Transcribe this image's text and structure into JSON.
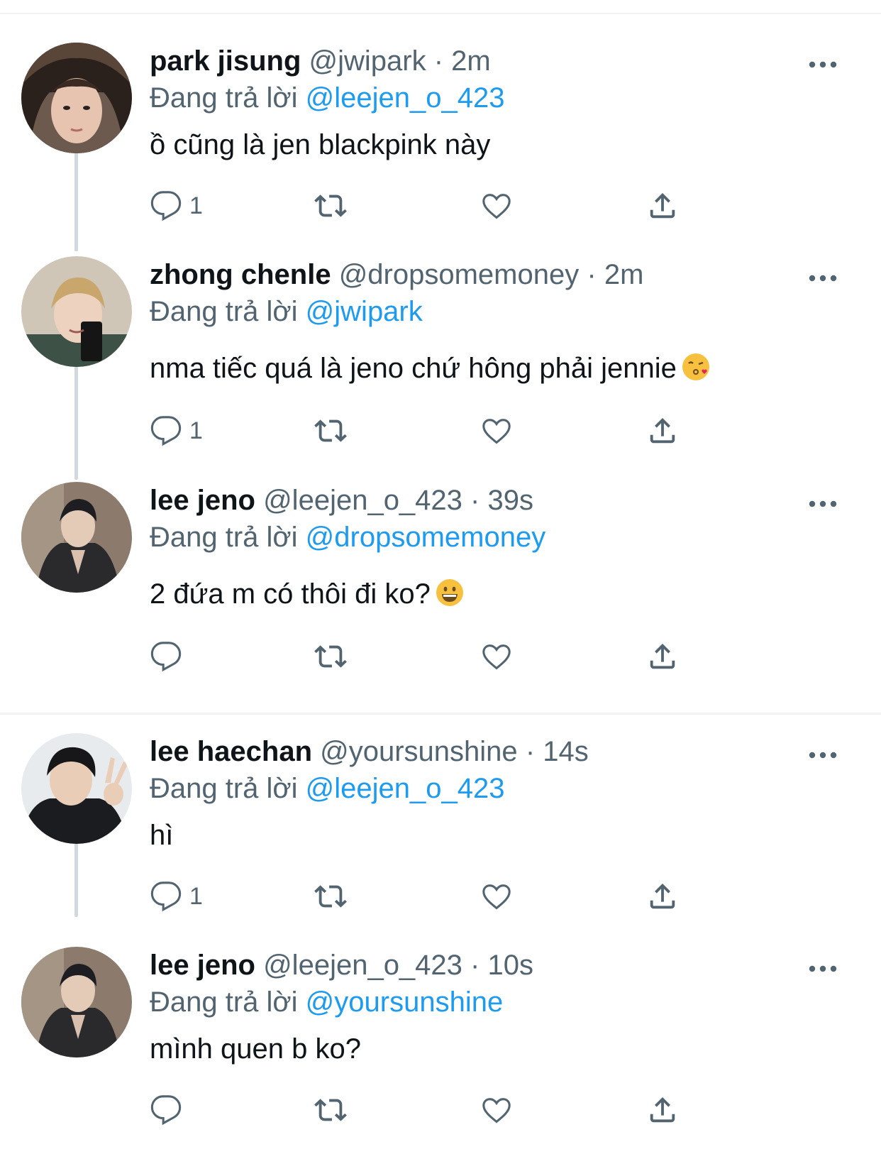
{
  "reply_prefix": "Đang trả lời",
  "colors": {
    "mention": "#1d9bf0",
    "muted": "#536471",
    "line": "#cfd9de"
  },
  "tweets": [
    {
      "name": "park jisung",
      "handle": "@jwipark",
      "separator": "·",
      "time": "2m",
      "replying_to": "@leejen_o_423",
      "text": "ồ cũng là jen blackpink này",
      "reply_count": "1"
    },
    {
      "name": "zhong chenle",
      "handle": "@dropsomemoney",
      "separator": "·",
      "time": "2m",
      "replying_to": "@jwipark",
      "text": "nma tiếc quá là jeno chứ hông phải jennie",
      "emoji": "kissing-heart-emoji",
      "reply_count": "1"
    },
    {
      "name": "lee jeno",
      "handle": "@leejen_o_423",
      "separator": "·",
      "time": "39s",
      "replying_to": "@dropsomemoney",
      "text": "2 đứa m có thôi đi ko?",
      "emoji": "grinning-emoji",
      "reply_count": ""
    },
    {
      "name": "lee haechan",
      "handle": "@yoursunshine",
      "separator": "·",
      "time": "14s",
      "replying_to": "@leejen_o_423",
      "text": "hì",
      "reply_count": "1"
    },
    {
      "name": "lee jeno",
      "handle": "@leejen_o_423",
      "separator": "·",
      "time": "10s",
      "replying_to": "@yoursunshine",
      "text": "mình quen b ko?",
      "reply_count": ""
    }
  ],
  "icons": {
    "reply": "reply-icon",
    "retweet": "retweet-icon",
    "like": "heart-icon",
    "share": "share-icon",
    "more": "more-options-icon"
  }
}
